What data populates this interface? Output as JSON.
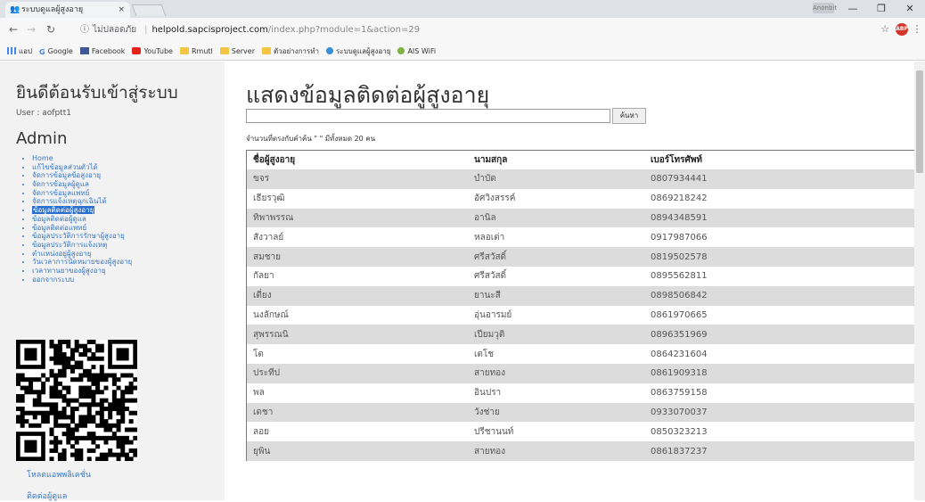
{
  "browser": {
    "tab_title": "ระบบดูแลผู้สูงอายุ",
    "tab_close": "×",
    "profile": "Anonbit",
    "url_security": "ไม่ปลอดภัย",
    "url_host": "helpold.sapcisproject.com",
    "url_path": "/index.php?module=1&action=29",
    "bookmarks": [
      {
        "label": "แอป",
        "icon": "apps-icon"
      },
      {
        "label": "Google",
        "icon": "google-icon"
      },
      {
        "label": "Facebook",
        "icon": "facebook-icon"
      },
      {
        "label": "YouTube",
        "icon": "youtube-icon"
      },
      {
        "label": "Rmutl",
        "icon": "folder-icon"
      },
      {
        "label": "Server",
        "icon": "folder-icon"
      },
      {
        "label": "ตัวอย่างการทำ",
        "icon": "folder-icon"
      },
      {
        "label": "ระบบดูแลผู้สูงอายุ",
        "icon": "user-icon"
      },
      {
        "label": "AIS WiFi",
        "icon": "wifi-icon"
      }
    ]
  },
  "sidebar": {
    "welcome": "ยินดีต้อนรับเข้าสู่ระบบ",
    "user": "User : aofptt1",
    "role": "Admin",
    "menu": [
      "Home",
      "แก้ไขข้อมูลส่วนตัวได้",
      "จัดการข้อมูลข้อสูงอายุ",
      "จัดการข้อมูลผู้ดูแล",
      "จัดการข้อมูลแพทย์",
      "จัดการแจ้งเหตุฉุกเฉินได้",
      "ข้อมูลติดต่อผู้สูงอายุ",
      "ข้อมูลติดต่อผู้ดูแล",
      "ข้อมูลติดต่อแพทย์",
      "ข้อมูลประวัติการรักษาผู้สูงอายุ",
      "ข้อมูลประวัติการแจ้งเหตุ",
      "ตำแหน่งอยู่ผู้สูงอายุ",
      "วันเวลาการนัดหมายของผู้สูงอายุ",
      "เวลาทานยาของผู้สูงอายุ",
      "ออกจากระบบ"
    ],
    "active_index": 6,
    "download_link": "โหลดแอพพลิเคชั่น",
    "contact_link": "ติดต่อผู้ดูแล"
  },
  "main": {
    "title": "แสดงข้อมูลติดต่อผู้สูงอายุ",
    "search_value": "",
    "search_button": "ค้นหา",
    "result_count": "จำนวนที่ตรงกับคำค้น \" \" มีทั้งหมด 20 คน",
    "columns": [
      "ชื่อผู้สูงอายุ",
      "นามสกุล",
      "เบอร์โทรศัพท์"
    ],
    "rows": [
      [
        "ขจร",
        "บำบัด",
        "0807934441"
      ],
      [
        "เธียรวุฒิ",
        "อัศวิงสรรค์",
        "0869218242"
      ],
      [
        "ทิพาพรรณ",
        "อานิล",
        "0894348591"
      ],
      [
        "สังวาลย์",
        "หลอเต่า",
        "0917987066"
      ],
      [
        "สมชาย",
        "ศรีสวัสดิ์",
        "0819502578"
      ],
      [
        "กัลยา",
        "ศรีสวัสดิ์",
        "0895562811"
      ],
      [
        "เตี่ยง",
        "ยานะสี",
        "0898506842"
      ],
      [
        "นงลักษณ์",
        "อุ่นอารมย์",
        "0861970665"
      ],
      [
        "สุพรรณนิ",
        "เปียมวุติ",
        "0896351969"
      ],
      [
        "โต",
        "เตโช",
        "0864231604"
      ],
      [
        "ประทีป",
        "สายทอง",
        "0861909318"
      ],
      [
        "พล",
        "อินปรา",
        "0863759158"
      ],
      [
        "เดชา",
        "วังช่าย",
        "0933070037"
      ],
      [
        "ลอย",
        "ปรีชานนท์",
        "0850323213"
      ],
      [
        "ยุพิน",
        "สายทอง",
        "0861837237"
      ]
    ]
  }
}
